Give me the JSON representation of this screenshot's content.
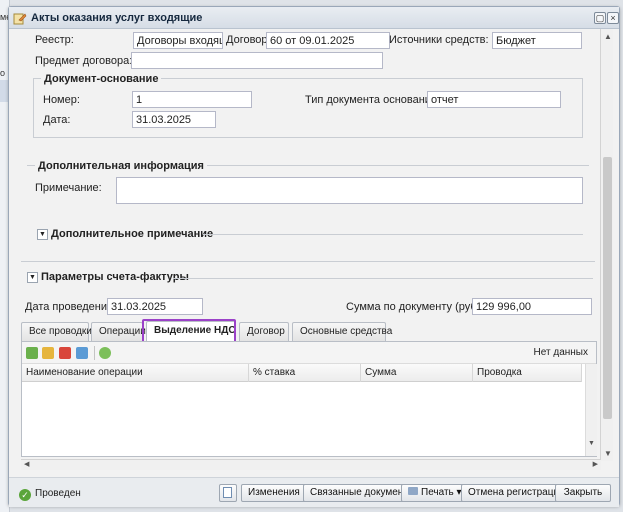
{
  "background": {
    "left_text_1": "ме",
    "left_text_2": "о"
  },
  "window": {
    "title": "Акты оказания услуг входящие"
  },
  "fields": {
    "registry_label": "Реестр:",
    "registry_value": "Договоры входящие",
    "contract_label": "Договор:",
    "contract_value": "60 от 09.01.2025",
    "funding_label": "Источники средств:",
    "funding_value": "Бюджет",
    "subject_label": "Предмет договора:",
    "subject_value": ""
  },
  "basis_doc": {
    "title": "Документ-основание",
    "number_label": "Номер:",
    "number_value": "1",
    "type_label": "Тип документа основания:",
    "type_value": "отчет",
    "date_label": "Дата:",
    "date_value": "31.03.2025"
  },
  "additional": {
    "title": "Дополнительная информация",
    "note_label": "Примечание:",
    "note_value": "",
    "extra_note_title": "Дополнительное примечание"
  },
  "invoice": {
    "title": "Параметры счета-фактуры",
    "date_label": "Дата проведения:",
    "date_value": "31.03.2025",
    "sum_label": "Сумма по документу (руб.):",
    "sum_value": "129 996,00"
  },
  "tabs": [
    {
      "label": "Все проводки"
    },
    {
      "label": "Операции"
    },
    {
      "label": "Выделение НДС"
    },
    {
      "label": "Договор"
    },
    {
      "label": "Основные средства"
    }
  ],
  "grid": {
    "no_data": "Нет данных",
    "columns": [
      "Наименование операции",
      "% ставка",
      "Сумма",
      "Проводка"
    ]
  },
  "footer": {
    "status": "Проведен",
    "buttons": [
      "Изменения",
      "Связанные документы",
      "Печать",
      "Отмена регистрации",
      "Закрыть"
    ]
  },
  "colors": {
    "highlight": "#9b42c8",
    "status_ok": "#5aa53a"
  }
}
